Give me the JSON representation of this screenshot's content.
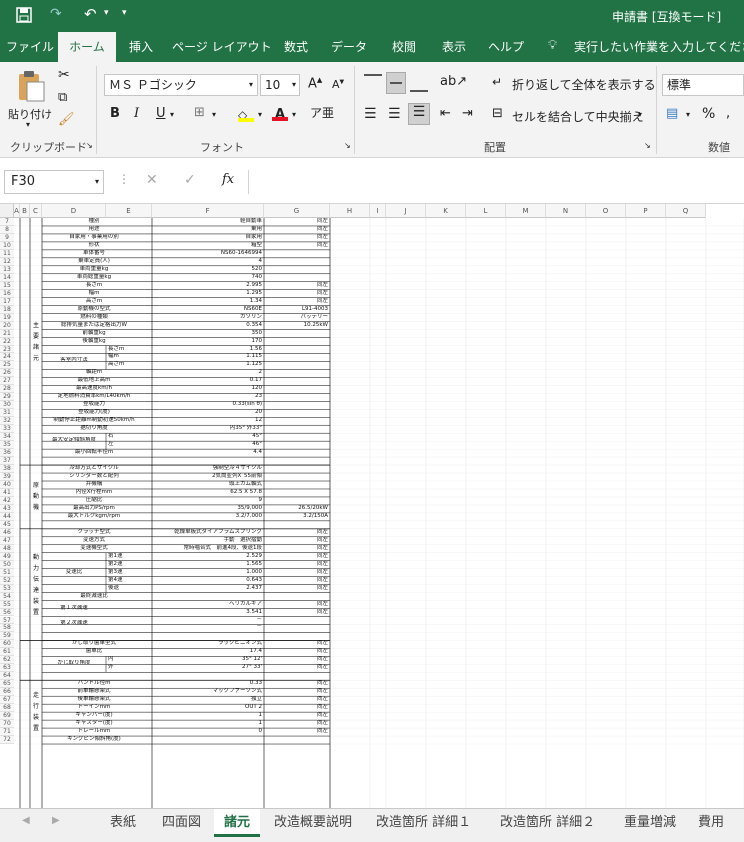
{
  "titlebar": {
    "title": "申請書 [互換モード]"
  },
  "tabs": [
    "ファイル",
    "ホーム",
    "挿入",
    "ページ レイアウト",
    "数式",
    "データ",
    "校閲",
    "表示",
    "ヘルプ"
  ],
  "tell_me": "実行したい作業を入力してください",
  "ribbon": {
    "paste": "貼り付け",
    "clipboard": "クリップボード",
    "font_name": "ＭＳ Ｐゴシック",
    "font_size": "10",
    "font_group": "フォント",
    "wrap": "折り返して全体を表示する",
    "merge": "セルを結合して中央揃え",
    "align_group": "配置",
    "number_format": "標準",
    "number_group": "数値",
    "bold": "B",
    "italic": "I",
    "underline": "U",
    "percent": "%"
  },
  "formula": {
    "name_box": "F30",
    "fx": "fx",
    "content": ""
  },
  "columns": [
    "A",
    "B",
    "C",
    "D",
    "E",
    "F",
    "G",
    "H",
    "I",
    "J",
    "K",
    "L",
    "M",
    "N",
    "O",
    "P",
    "Q"
  ],
  "rows": [
    {
      "n": "7",
      "c": "種別",
      "e": "軽自動車",
      "f": "同左"
    },
    {
      "n": "8",
      "c": "用途",
      "e": "乗用",
      "f": "同左"
    },
    {
      "n": "9",
      "c": "自家用・事業用の別",
      "e": "自家用",
      "f": "同左"
    },
    {
      "n": "10",
      "c": "形状",
      "e": "箱型",
      "f": "同左"
    },
    {
      "n": "11",
      "c": "車体番号",
      "e": "NS60-1646994",
      "f": ""
    },
    {
      "n": "12",
      "c": "乗車定員(人)",
      "e": "4",
      "f": ""
    },
    {
      "n": "13",
      "c": "車両重量kg",
      "e": "520",
      "f": ""
    },
    {
      "n": "14",
      "c": "車両総重量kg",
      "e": "740",
      "f": ""
    },
    {
      "n": "15",
      "c": "長さm",
      "e": "2.995",
      "f": "同左"
    },
    {
      "n": "16",
      "c": "幅m",
      "e": "1.295",
      "f": "同左"
    },
    {
      "n": "17",
      "c": "高さm",
      "e": "1.34",
      "f": "同左"
    },
    {
      "n": "18",
      "c": "原動機の型式",
      "e": "NS60E",
      "f": "L91-4003"
    },
    {
      "n": "19",
      "c": "燃料の種類",
      "e": "ガソリン",
      "f": "バッテリー"
    },
    {
      "n": "20",
      "c": "総排気量または定格出力W",
      "e": "0.354",
      "f": "10.25kW"
    },
    {
      "n": "21",
      "c": "前軸重kg",
      "e": "350",
      "f": ""
    },
    {
      "n": "22",
      "c": "後軸重kg",
      "e": "170",
      "f": ""
    },
    {
      "n": "23",
      "c": "",
      "d": "長さm",
      "e": "1.56",
      "f": ""
    },
    {
      "n": "24",
      "c": "",
      "d": "幅m",
      "e": "1.115",
      "f": ""
    },
    {
      "n": "25",
      "c": "",
      "d": "高さm",
      "e": "1.125",
      "f": ""
    },
    {
      "n": "26",
      "c": "軸距m",
      "e": "2",
      "f": ""
    },
    {
      "n": "27",
      "c": "最低地上高m",
      "e": "0.17",
      "f": ""
    },
    {
      "n": "28",
      "c": "最高速度km/h",
      "e": "120",
      "f": ""
    },
    {
      "n": "29",
      "c": "定地燃料消費率km/L40km/h",
      "e": "23",
      "f": ""
    },
    {
      "n": "30",
      "c": "登坂能力",
      "e": "0.33(sin θ)",
      "f": ""
    },
    {
      "n": "31",
      "c": "登坂能力(度)",
      "e": "20",
      "f": ""
    },
    {
      "n": "32",
      "c": "制動停止距離m制動初速50km/h",
      "e": "12",
      "f": ""
    },
    {
      "n": "33",
      "c": "据切り角度",
      "e": "内35° 外33°",
      "f": ""
    },
    {
      "n": "34",
      "c": "",
      "d": "右",
      "e": "45°",
      "f": ""
    },
    {
      "n": "35",
      "c": "",
      "d": "左",
      "e": "46°",
      "f": ""
    },
    {
      "n": "36",
      "c": "最小回転半径m",
      "e": "4.4",
      "f": ""
    },
    {
      "n": "37",
      "c": "",
      "e": "",
      "f": ""
    },
    {
      "n": "38",
      "c": "冷却方式とサイクル",
      "e": "強制空冷４サイクル",
      "f": ""
    },
    {
      "n": "39",
      "c": "シリンダー数と配列",
      "e": "2気筒並列X´55前傾",
      "f": ""
    },
    {
      "n": "40",
      "c": "弁機構",
      "e": "頭上カム軸式",
      "f": ""
    },
    {
      "n": "41",
      "c": "内径X行程mm",
      "e": "62.5 X 57.8",
      "f": ""
    },
    {
      "n": "42",
      "c": "圧縮比",
      "e": "9",
      "f": ""
    },
    {
      "n": "43",
      "c": "最高出力PS/rpm",
      "e": "35/9,000",
      "f": "26.5/20kW"
    },
    {
      "n": "44",
      "c": "最大トルクkgm/rpm",
      "e": "3.2/7,000",
      "f": "3.2/150A"
    },
    {
      "n": "45",
      "c": "",
      "e": "",
      "f": ""
    },
    {
      "n": "46",
      "c": "クラッチ型式",
      "e": "乾燥単板式ダイアフラムスプリング",
      "f": "同左"
    },
    {
      "n": "47",
      "c": "変速方式",
      "e": "手動　選択摺動",
      "f": "同左"
    },
    {
      "n": "48",
      "c": "変速機型式",
      "e": "常時噛合式　前進4段、後退1段",
      "f": "同左"
    },
    {
      "n": "49",
      "c": "",
      "d": "第1速",
      "e": "2.529",
      "f": "同左"
    },
    {
      "n": "50",
      "c": "",
      "d": "第2速",
      "e": "1.565",
      "f": "同左"
    },
    {
      "n": "51",
      "c": "",
      "d": "第3速",
      "e": "1.000",
      "f": "同左"
    },
    {
      "n": "52",
      "c": "",
      "d": "第4速",
      "e": "0.643",
      "f": "同左"
    },
    {
      "n": "53",
      "c": "",
      "d": "後退",
      "e": "2.437",
      "f": "同左"
    },
    {
      "n": "54",
      "c": "最終減速比",
      "e": "",
      "f": ""
    },
    {
      "n": "55",
      "c": "",
      "e": "ヘリカルギア",
      "f": "同左"
    },
    {
      "n": "56",
      "c": "",
      "e": "3.541",
      "f": "同左"
    },
    {
      "n": "57",
      "c": "",
      "e": "－",
      "f": ""
    },
    {
      "n": "58",
      "c": "",
      "e": "－",
      "f": ""
    },
    {
      "n": "59",
      "c": "",
      "e": "",
      "f": ""
    },
    {
      "n": "60",
      "c": "かじ取り歯車型式",
      "e": "ラックピニオン式",
      "f": "同左"
    },
    {
      "n": "61",
      "c": "歯車比",
      "e": "17.4",
      "f": "同左"
    },
    {
      "n": "62",
      "c": "",
      "d": "内",
      "e": "35° 12'",
      "f": "同左"
    },
    {
      "n": "63",
      "c": "",
      "d": "外",
      "e": "27° 33'",
      "f": "同左"
    },
    {
      "n": "64",
      "c": "",
      "e": "",
      "f": ""
    },
    {
      "n": "65",
      "c": "ハンドル径m",
      "e": "0.33",
      "f": "同左"
    },
    {
      "n": "66",
      "c": "前車輪懸架式",
      "e": "マックファーソン式",
      "f": "同左"
    },
    {
      "n": "67",
      "c": "後車輪懸架式",
      "e": "独立",
      "f": "同左"
    },
    {
      "n": "68",
      "c": "トーインmm",
      "e": "OUT 2",
      "f": "同左"
    },
    {
      "n": "69",
      "c": "キャンバー(度)",
      "e": "1",
      "f": "同左"
    },
    {
      "n": "70",
      "c": "キャスター(度)",
      "e": "1",
      "f": "同左"
    },
    {
      "n": "71",
      "c": "トレールmm",
      "e": "0",
      "f": "同左"
    },
    {
      "n": "72",
      "c": "キングピン傾斜角(度)",
      "e": "",
      "f": ""
    }
  ],
  "merged_labels": {
    "cabin": "客室内寸法",
    "max_steer": "最大安定傾斜角度",
    "gear_ratio": "変速比",
    "first_reduction": "第１次減速",
    "second_reduction": "第２次減速",
    "steer_angle": "かじ取り角度"
  },
  "sections": [
    {
      "label": "主要諸元"
    },
    {
      "label": "原動機"
    },
    {
      "label": "動力伝達装置"
    },
    {
      "label": "走行装置"
    }
  ],
  "sheet_tabs": [
    "表紙",
    "四面図",
    "諸元",
    "改造概要説明",
    "改造箇所 詳細１",
    "改造箇所 詳細２",
    "重量増減",
    "費用"
  ],
  "active_sheet": "諸元"
}
